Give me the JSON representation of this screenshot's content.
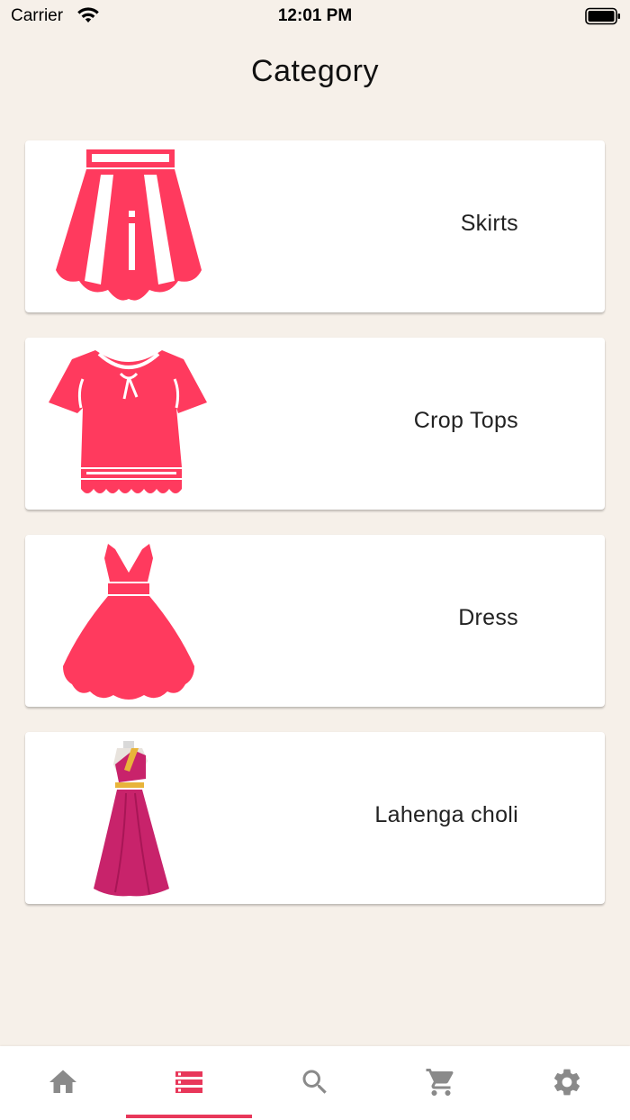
{
  "status_bar": {
    "carrier": "Carrier",
    "time": "12:01 PM",
    "icons": [
      "wifi-icon",
      "battery-icon"
    ]
  },
  "header": {
    "title": "Category"
  },
  "categories": [
    {
      "label": "Skirts",
      "icon": "skirt-icon",
      "color": "#ff3a5e"
    },
    {
      "label": "Crop Tops",
      "icon": "crop-top-icon",
      "color": "#ff3a5e"
    },
    {
      "label": "Dress",
      "icon": "dress-icon",
      "color": "#ff3a5e"
    },
    {
      "label": "Lahenga choli",
      "icon": "lahenga-choli-icon",
      "color": "#c8236b"
    }
  ],
  "bottom_nav": {
    "items": [
      {
        "icon": "home-icon",
        "active": false
      },
      {
        "icon": "category-list-icon",
        "active": true
      },
      {
        "icon": "search-icon",
        "active": false
      },
      {
        "icon": "cart-icon",
        "active": false
      },
      {
        "icon": "settings-gear-icon",
        "active": false
      }
    ],
    "active_color": "#e8375a",
    "inactive_color": "#8a8a8a"
  },
  "colors": {
    "background": "#f6f0e9",
    "card": "#ffffff",
    "accent": "#ff3a5e"
  }
}
